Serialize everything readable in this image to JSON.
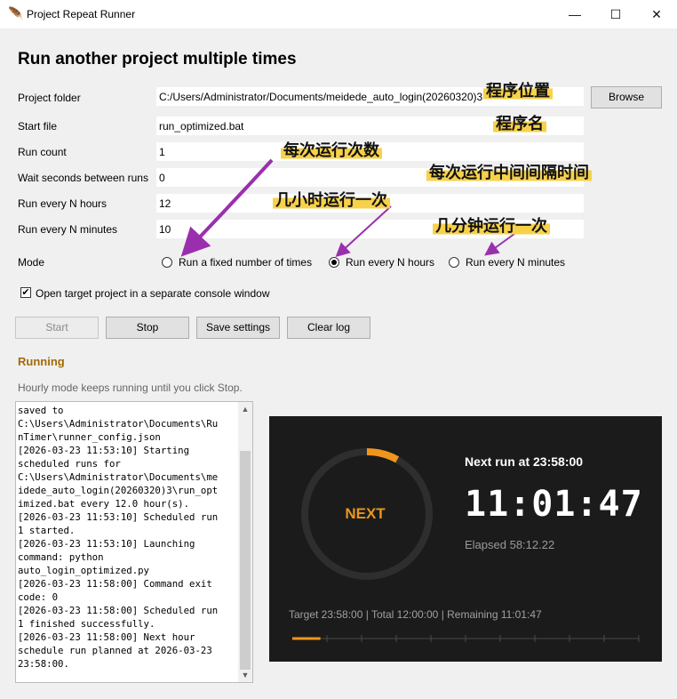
{
  "window": {
    "title": "Project Repeat Runner",
    "controls": {
      "minimize": "—",
      "maximize": "☐",
      "close": "✕"
    }
  },
  "heading": "Run another project multiple times",
  "form": {
    "project_folder": {
      "label": "Project folder",
      "value": "C:/Users/Administrator/Documents/meidede_auto_login(20260320)3"
    },
    "browse_label": "Browse",
    "start_file": {
      "label": "Start file",
      "value": "run_optimized.bat"
    },
    "run_count": {
      "label": "Run count",
      "value": "1"
    },
    "wait_seconds": {
      "label": "Wait seconds between runs",
      "value": "0"
    },
    "every_hours": {
      "label": "Run every N hours",
      "value": "12"
    },
    "every_minutes": {
      "label": "Run every N minutes",
      "value": "10"
    },
    "mode": {
      "label": "Mode",
      "options": [
        "Run a fixed number of times",
        "Run every N hours",
        "Run every N minutes"
      ],
      "selected": "Run every N hours"
    },
    "console_checkbox": {
      "label": "Open target project in a separate console window",
      "checked": true
    }
  },
  "buttons": {
    "start": "Start",
    "stop": "Stop",
    "save": "Save settings",
    "clear": "Clear log"
  },
  "status": {
    "state": "Running",
    "hint": "Hourly mode keeps running until you click Stop.",
    "color": "#a46a00"
  },
  "log": {
    "text": "saved to\nC:\\Users\\Administrator\\Documents\\Ru\nnTimer\\runner_config.json\n[2026-03-23 11:53:10] Starting\nscheduled runs for\nC:\\Users\\Administrator\\Documents\\me\nidede_auto_login(20260320)3\\run_opt\nimized.bat every 12.0 hour(s).\n[2026-03-23 11:53:10] Scheduled run\n1 started.\n[2026-03-23 11:53:10] Launching\ncommand: python\nauto_login_optimized.py\n[2026-03-23 11:58:00] Command exit\ncode: 0\n[2026-03-23 11:58:00] Scheduled run\n1 finished successfully.\n[2026-03-23 11:58:00] Next hour\nschedule run planned at 2026-03-23\n23:58:00."
  },
  "timer_panel": {
    "ring_label": "NEXT",
    "next_run": "Next run at 23:58:00",
    "countdown": "11:01:47",
    "elapsed": "Elapsed 58:12.22",
    "summary": "Target 23:58:00 | Total 12:00:00 | Remaining 11:01:47",
    "progress_fraction": 0.081,
    "accent_color": "#f0961c",
    "track_color": "#2e2e2e"
  },
  "annotations": {
    "project_location": "程序位置",
    "program_name": "程序名",
    "runs_each_time": "每次运行次数",
    "interval_between_runs": "每次运行中间间隔时间",
    "run_every_hours": "几小时运行一次",
    "run_every_minutes": "几分钟运行一次",
    "arrow_color": "#9a2fae",
    "highlight_color": "#f7d14a"
  }
}
